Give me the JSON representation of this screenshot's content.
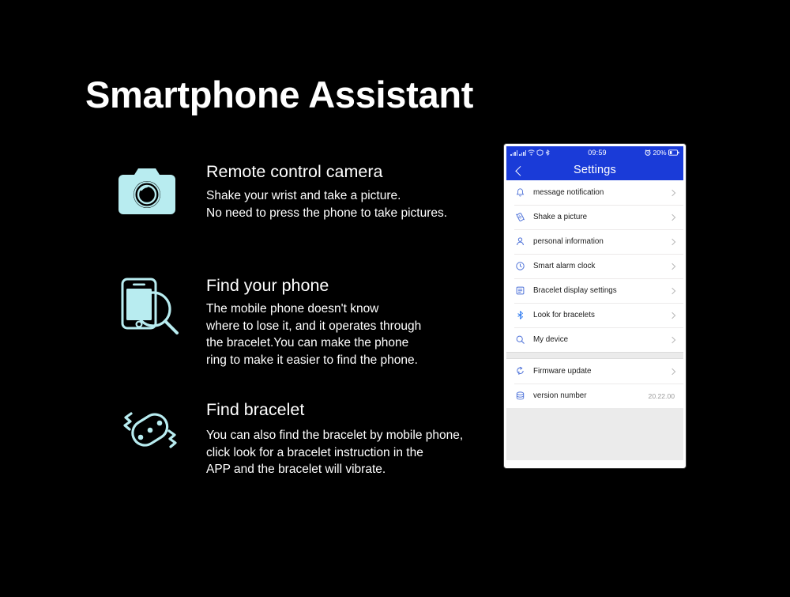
{
  "page": {
    "background_color": "#000000",
    "title": "Smartphone Assistant",
    "accent_icon_color": "#b8ecf0"
  },
  "features": [
    {
      "icon": "camera-icon",
      "title": "Remote control camera",
      "description": "Shake your wrist and take a picture.\nNo need to press the phone to take pictures."
    },
    {
      "icon": "find-phone-icon",
      "title": "Find your phone",
      "description": "The mobile phone doesn't know\nwhere to lose it, and it operates through\nthe bracelet.You can make the phone\nring to make it easier to find the phone."
    },
    {
      "icon": "find-bracelet-icon",
      "title": "Find bracelet",
      "description": "You can also find the bracelet by mobile phone,\n click  look for a bracelet instruction in the\nAPP and the bracelet will vibrate."
    }
  ],
  "phone": {
    "status_bar": {
      "time": "09:59",
      "battery_percent": "20%",
      "alarm_icon": "alarm-clock-icon",
      "wifi_icon": "wifi-icon",
      "signal_icon": "signal-bars-icon",
      "battery_icon": "battery-icon",
      "bar_color": "#1a3bd8"
    },
    "nav": {
      "back_icon": "chevron-left-icon",
      "title": "Settings"
    },
    "settings_groups": [
      {
        "rows": [
          {
            "icon": "bell-icon",
            "label": "message notification",
            "value": "",
            "chevron": true
          },
          {
            "icon": "shake-icon",
            "label": "Shake a picture",
            "value": "",
            "chevron": true
          },
          {
            "icon": "person-icon",
            "label": "personal information",
            "value": "",
            "chevron": true
          },
          {
            "icon": "clock-icon",
            "label": "Smart alarm clock",
            "value": "",
            "chevron": true
          },
          {
            "icon": "display-list-icon",
            "label": "Bracelet display settings",
            "value": "",
            "chevron": true
          },
          {
            "icon": "bluetooth-icon",
            "label": "Look for bracelets",
            "value": "",
            "chevron": true
          },
          {
            "icon": "search-icon",
            "label": "My device",
            "value": "",
            "chevron": true
          }
        ]
      },
      {
        "rows": [
          {
            "icon": "firmware-update-icon",
            "label": "Firmware update",
            "value": "",
            "chevron": true
          },
          {
            "icon": "database-icon",
            "label": "version number",
            "value": "20.22.00",
            "chevron": false
          }
        ]
      }
    ]
  }
}
